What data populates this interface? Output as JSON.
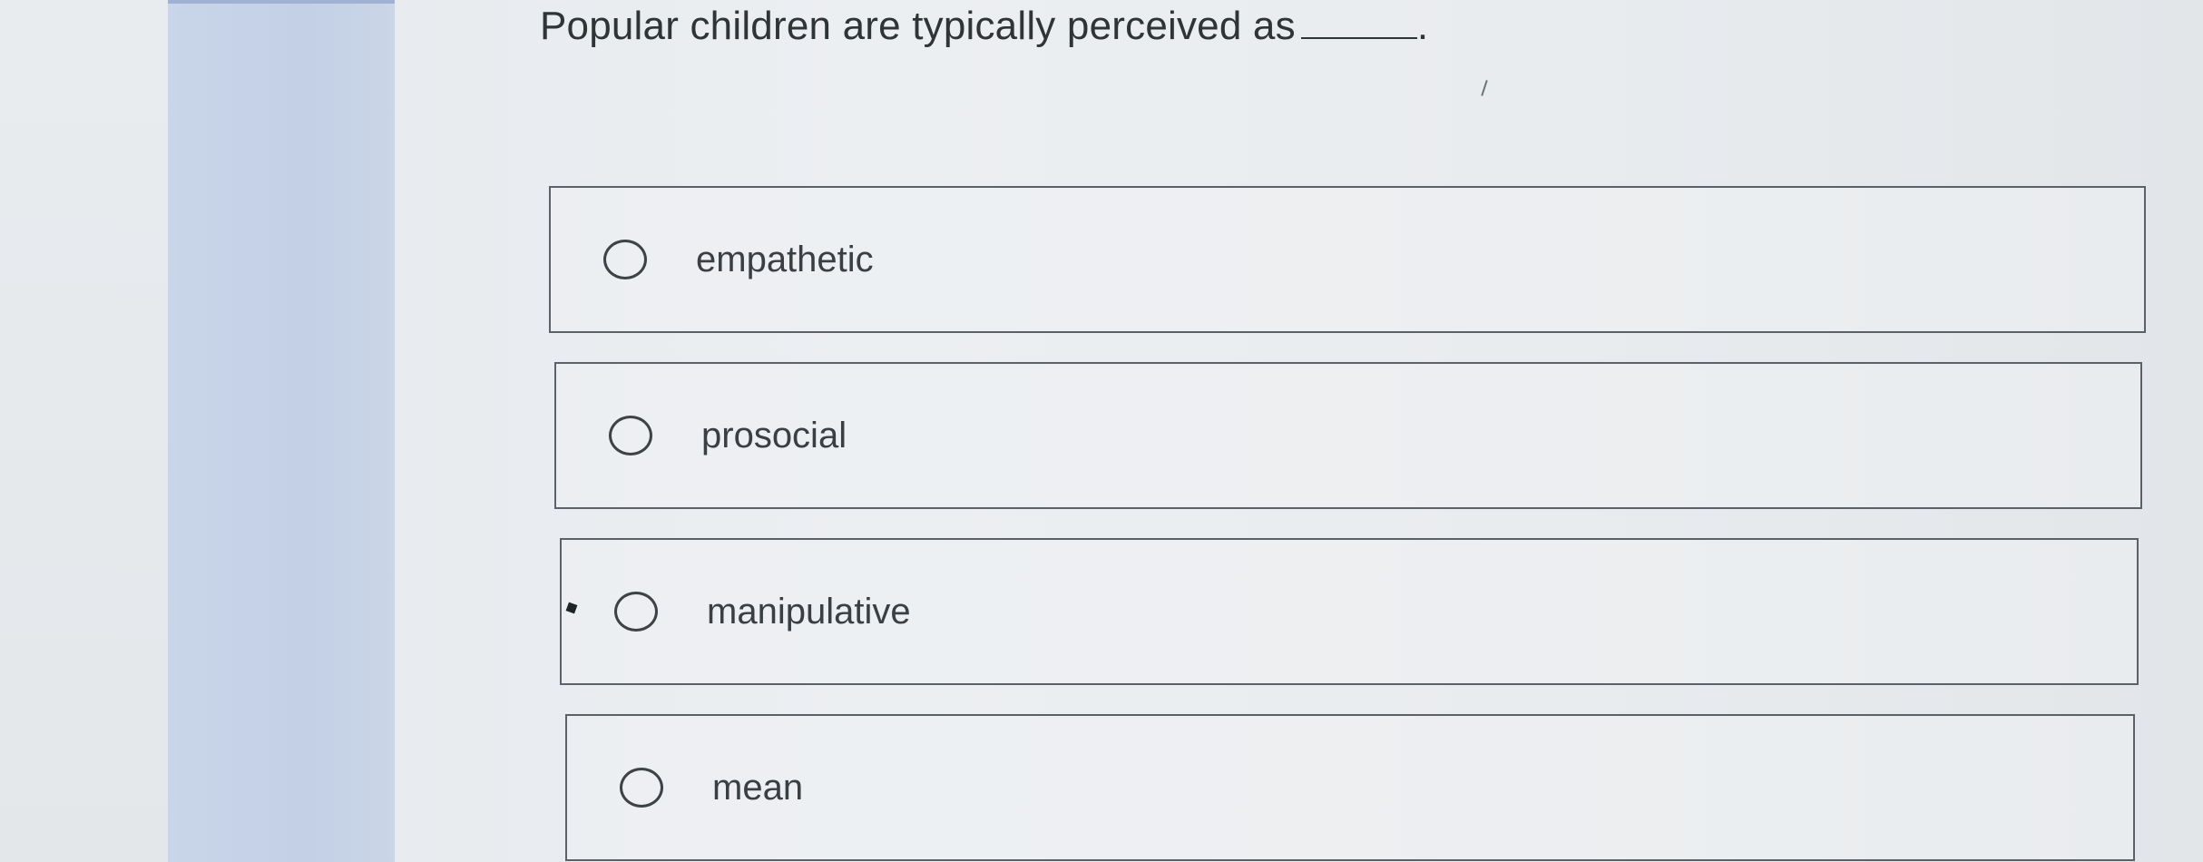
{
  "question": {
    "prompt": "Popular children are typically perceived as",
    "terminal_punctuation": "."
  },
  "options": [
    {
      "label": "empathetic",
      "selected": false
    },
    {
      "label": "prosocial",
      "selected": false
    },
    {
      "label": "manipulative",
      "selected": false
    },
    {
      "label": "mean",
      "selected": false
    }
  ],
  "colors": {
    "side_rail": "#c7d3e8",
    "option_border": "#5b6166",
    "text": "#2f3437"
  }
}
